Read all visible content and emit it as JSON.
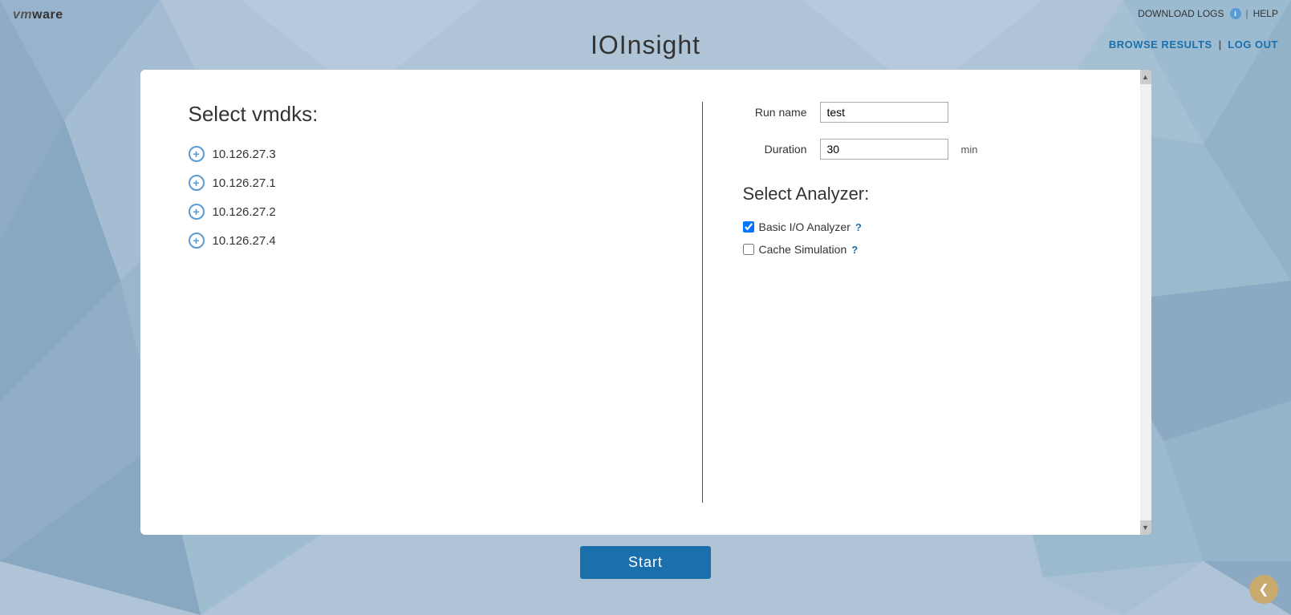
{
  "header": {
    "logo_text": "vm ware",
    "title": "IOInsight",
    "download_logs_label": "DOWNLOAD LOGS",
    "help_label": "HELP",
    "browse_results_label": "BROWSE RESULTS",
    "log_out_label": "LOG OUT"
  },
  "left": {
    "select_vmdks_label": "Select vmdks:",
    "vmdks": [
      {
        "id": "vmdk-1",
        "label": "10.126.27.3"
      },
      {
        "id": "vmdk-2",
        "label": "10.126.27.1"
      },
      {
        "id": "vmdk-3",
        "label": "10.126.27.2"
      },
      {
        "id": "vmdk-4",
        "label": "10.126.27.4"
      }
    ]
  },
  "right": {
    "run_name_label": "Run name",
    "run_name_value": "test",
    "duration_label": "Duration",
    "duration_value": "30",
    "duration_unit": "min",
    "select_analyzer_label": "Select Analyzer:",
    "analyzers": [
      {
        "id": "basic-io",
        "label": "Basic I/O Analyzer",
        "checked": true,
        "help": "?"
      },
      {
        "id": "cache-sim",
        "label": "Cache Simulation",
        "checked": false,
        "help": "?"
      }
    ]
  },
  "footer": {
    "start_button_label": "Start"
  },
  "scrollbar": {
    "up_arrow": "▲",
    "down_arrow": "▼"
  },
  "collapse": {
    "arrow": "❮"
  }
}
